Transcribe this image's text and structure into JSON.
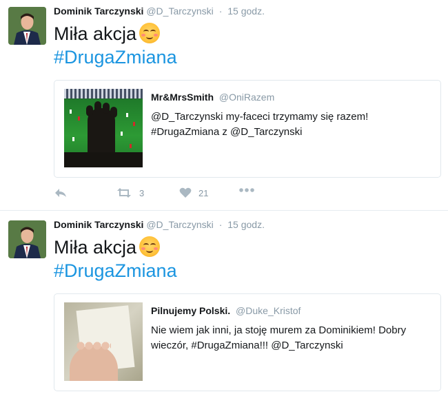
{
  "tweets": [
    {
      "author": "Dominik Tarczynski",
      "handle": "@D_Tarczynski",
      "time": "15 godz.",
      "text": "Miła akcja",
      "hashtag": "#DrugaZmiana",
      "quote": {
        "author": "Mr&MrsSmith",
        "handle": "@OniRazem",
        "text": "@D_Tarczynski my-faceci trzymamy się razem! #DrugaZmiana z @D_Tarczynski",
        "image": "foot-over-football-match-tv"
      },
      "actions": {
        "reply_icon": "reply-icon",
        "retweet_icon": "retweet-icon",
        "retweets": "3",
        "like_icon": "heart-icon",
        "likes": "21",
        "more_icon": "more-icon"
      }
    },
    {
      "author": "Dominik Tarczynski",
      "handle": "@D_Tarczynski",
      "time": "15 godz.",
      "text": "Miła akcja",
      "hashtag": "#DrugaZmiana",
      "quote": {
        "author": "Pilnujemy Polski.",
        "handle": "@Duke_Kristof",
        "text": "Nie wiem jak inni, ja stoję murem za Dominikiem! Dobry wieczór, #DrugaZmiana!!!  @D_Tarczynski",
        "image": "foot-with-paper-sign"
      }
    }
  ],
  "colors": {
    "link": "#1b95e0",
    "muted": "#8899a6",
    "border": "#e1e8ed"
  }
}
